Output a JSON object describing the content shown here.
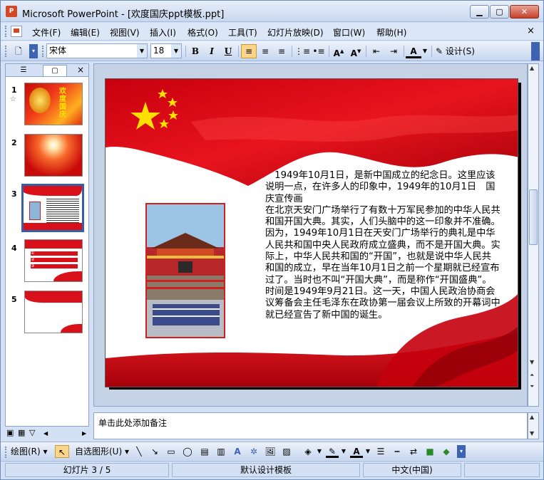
{
  "window": {
    "title": "Microsoft PowerPoint - [欢度国庆ppt模板.ppt]",
    "app_icon": "P"
  },
  "menu": {
    "items": [
      "文件(F)",
      "编辑(E)",
      "视图(V)",
      "插入(I)",
      "格式(O)",
      "工具(T)",
      "幻灯片放映(D)",
      "窗口(W)",
      "帮助(H)"
    ],
    "close": "×"
  },
  "toolbar": {
    "font_name": "宋体",
    "font_size": "18",
    "bold": "B",
    "italic": "I",
    "underline": "U",
    "design": "设计(S)"
  },
  "slides_pane": {
    "close": "×",
    "thumbnails": [
      {
        "number": "1",
        "star": "☆",
        "caption": "欢度国庆"
      },
      {
        "number": "2"
      },
      {
        "number": "3",
        "selected": true
      },
      {
        "number": "4",
        "items": [
          "①",
          "②",
          "③"
        ]
      },
      {
        "number": "5"
      }
    ]
  },
  "slide": {
    "paragraphs": [
      "　1949年10月1日，是新中国成立的纪念日。这里应该说明一点，在许多人的印象中，1949年的10月1日　国庆宣传画",
      "在北京天安门广场举行了有数十万军民参加的中华人民共和国开国大典。其实，人们头脑中的这一印象并不准确。因为，1949年10月1日在天安门广场举行的典礼是中华人民共和国中央人民政府成立盛典，而不是开国大典。实际上，中华人民共和国的“开国”，也就是说中华人民共和国的成立，早在当年10月1日之前一个星期就已经宣布过了。当时也不叫“开国大典”，而是称作“开国盛典”。时间是1949年9月21日。这一天，中国人民政治协商会议筹备会主任毛泽东在政协第一届会议上所致的开幕词中就已经宣告了新中国的诞生。"
    ]
  },
  "notes": {
    "placeholder": "单击此处添加备注"
  },
  "drawing_toolbar": {
    "draw": "绘图(R)",
    "autoshapes": "自选图形(U)"
  },
  "status": {
    "slide_position": "幻灯片 3 / 5",
    "template": "默认设计模板",
    "language": "中文(中国)"
  },
  "colors": {
    "flag_red": "#d8101a",
    "star_yellow": "#ffde00",
    "selection_blue": "#3560a8"
  }
}
